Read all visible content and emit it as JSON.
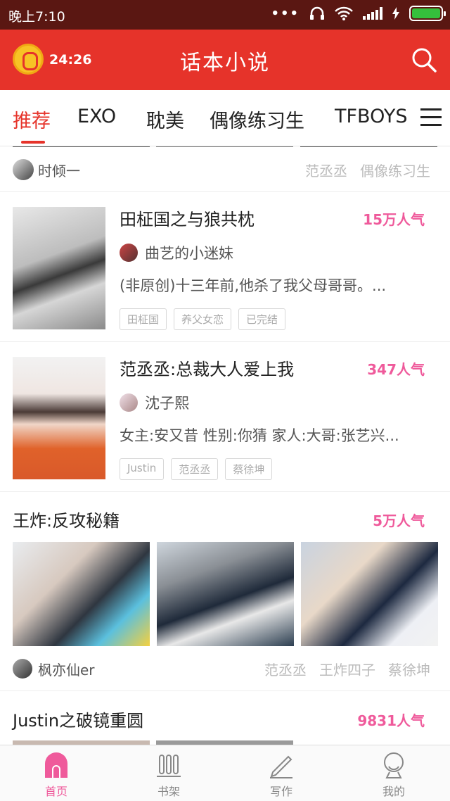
{
  "status_bar": {
    "time": "晚上7:10",
    "dots": "•••"
  },
  "header": {
    "alarm_time": "24:26",
    "title": "话本小说"
  },
  "tabs": [
    {
      "label": "推荐"
    },
    {
      "label": "EXO"
    },
    {
      "label": "耽美"
    },
    {
      "label": "偶像练习生"
    },
    {
      "label": "TFBOYS"
    }
  ],
  "author_row": {
    "name": "时倾一",
    "tags": [
      "范丞丞",
      "偶像练习生"
    ]
  },
  "items": [
    {
      "title": "田柾国之与狼共枕",
      "popularity": "15万人气",
      "author": "曲艺的小迷妹",
      "desc": "(非原创)十三年前,他杀了我父母哥哥。...",
      "tags": [
        "田柾国",
        "养父女恋",
        "已完结"
      ]
    },
    {
      "title": "范丞丞:总裁大人爱上我",
      "popularity": "347人气",
      "author": "沈子熙",
      "desc": "女主:安又昔 性别:你猜 家人:大哥:张艺兴...",
      "tags": [
        "Justin",
        "范丞丞",
        "蔡徐坤"
      ]
    }
  ],
  "big_item": {
    "title": "王炸:反攻秘籍",
    "popularity": "5万人气",
    "author": "枫亦仙er",
    "tags": [
      "范丞丞",
      "王炸四子",
      "蔡徐坤"
    ]
  },
  "last_item": {
    "title": "Justin之破镜重圆",
    "popularity": "9831人气"
  },
  "bottom_nav": [
    {
      "label": "首页"
    },
    {
      "label": "书架"
    },
    {
      "label": "写作"
    },
    {
      "label": "我的"
    }
  ],
  "colors": {
    "brand_red": "#e6332a",
    "popularity_pink": "#ef5a9b",
    "status_bar": "#5a1712"
  }
}
